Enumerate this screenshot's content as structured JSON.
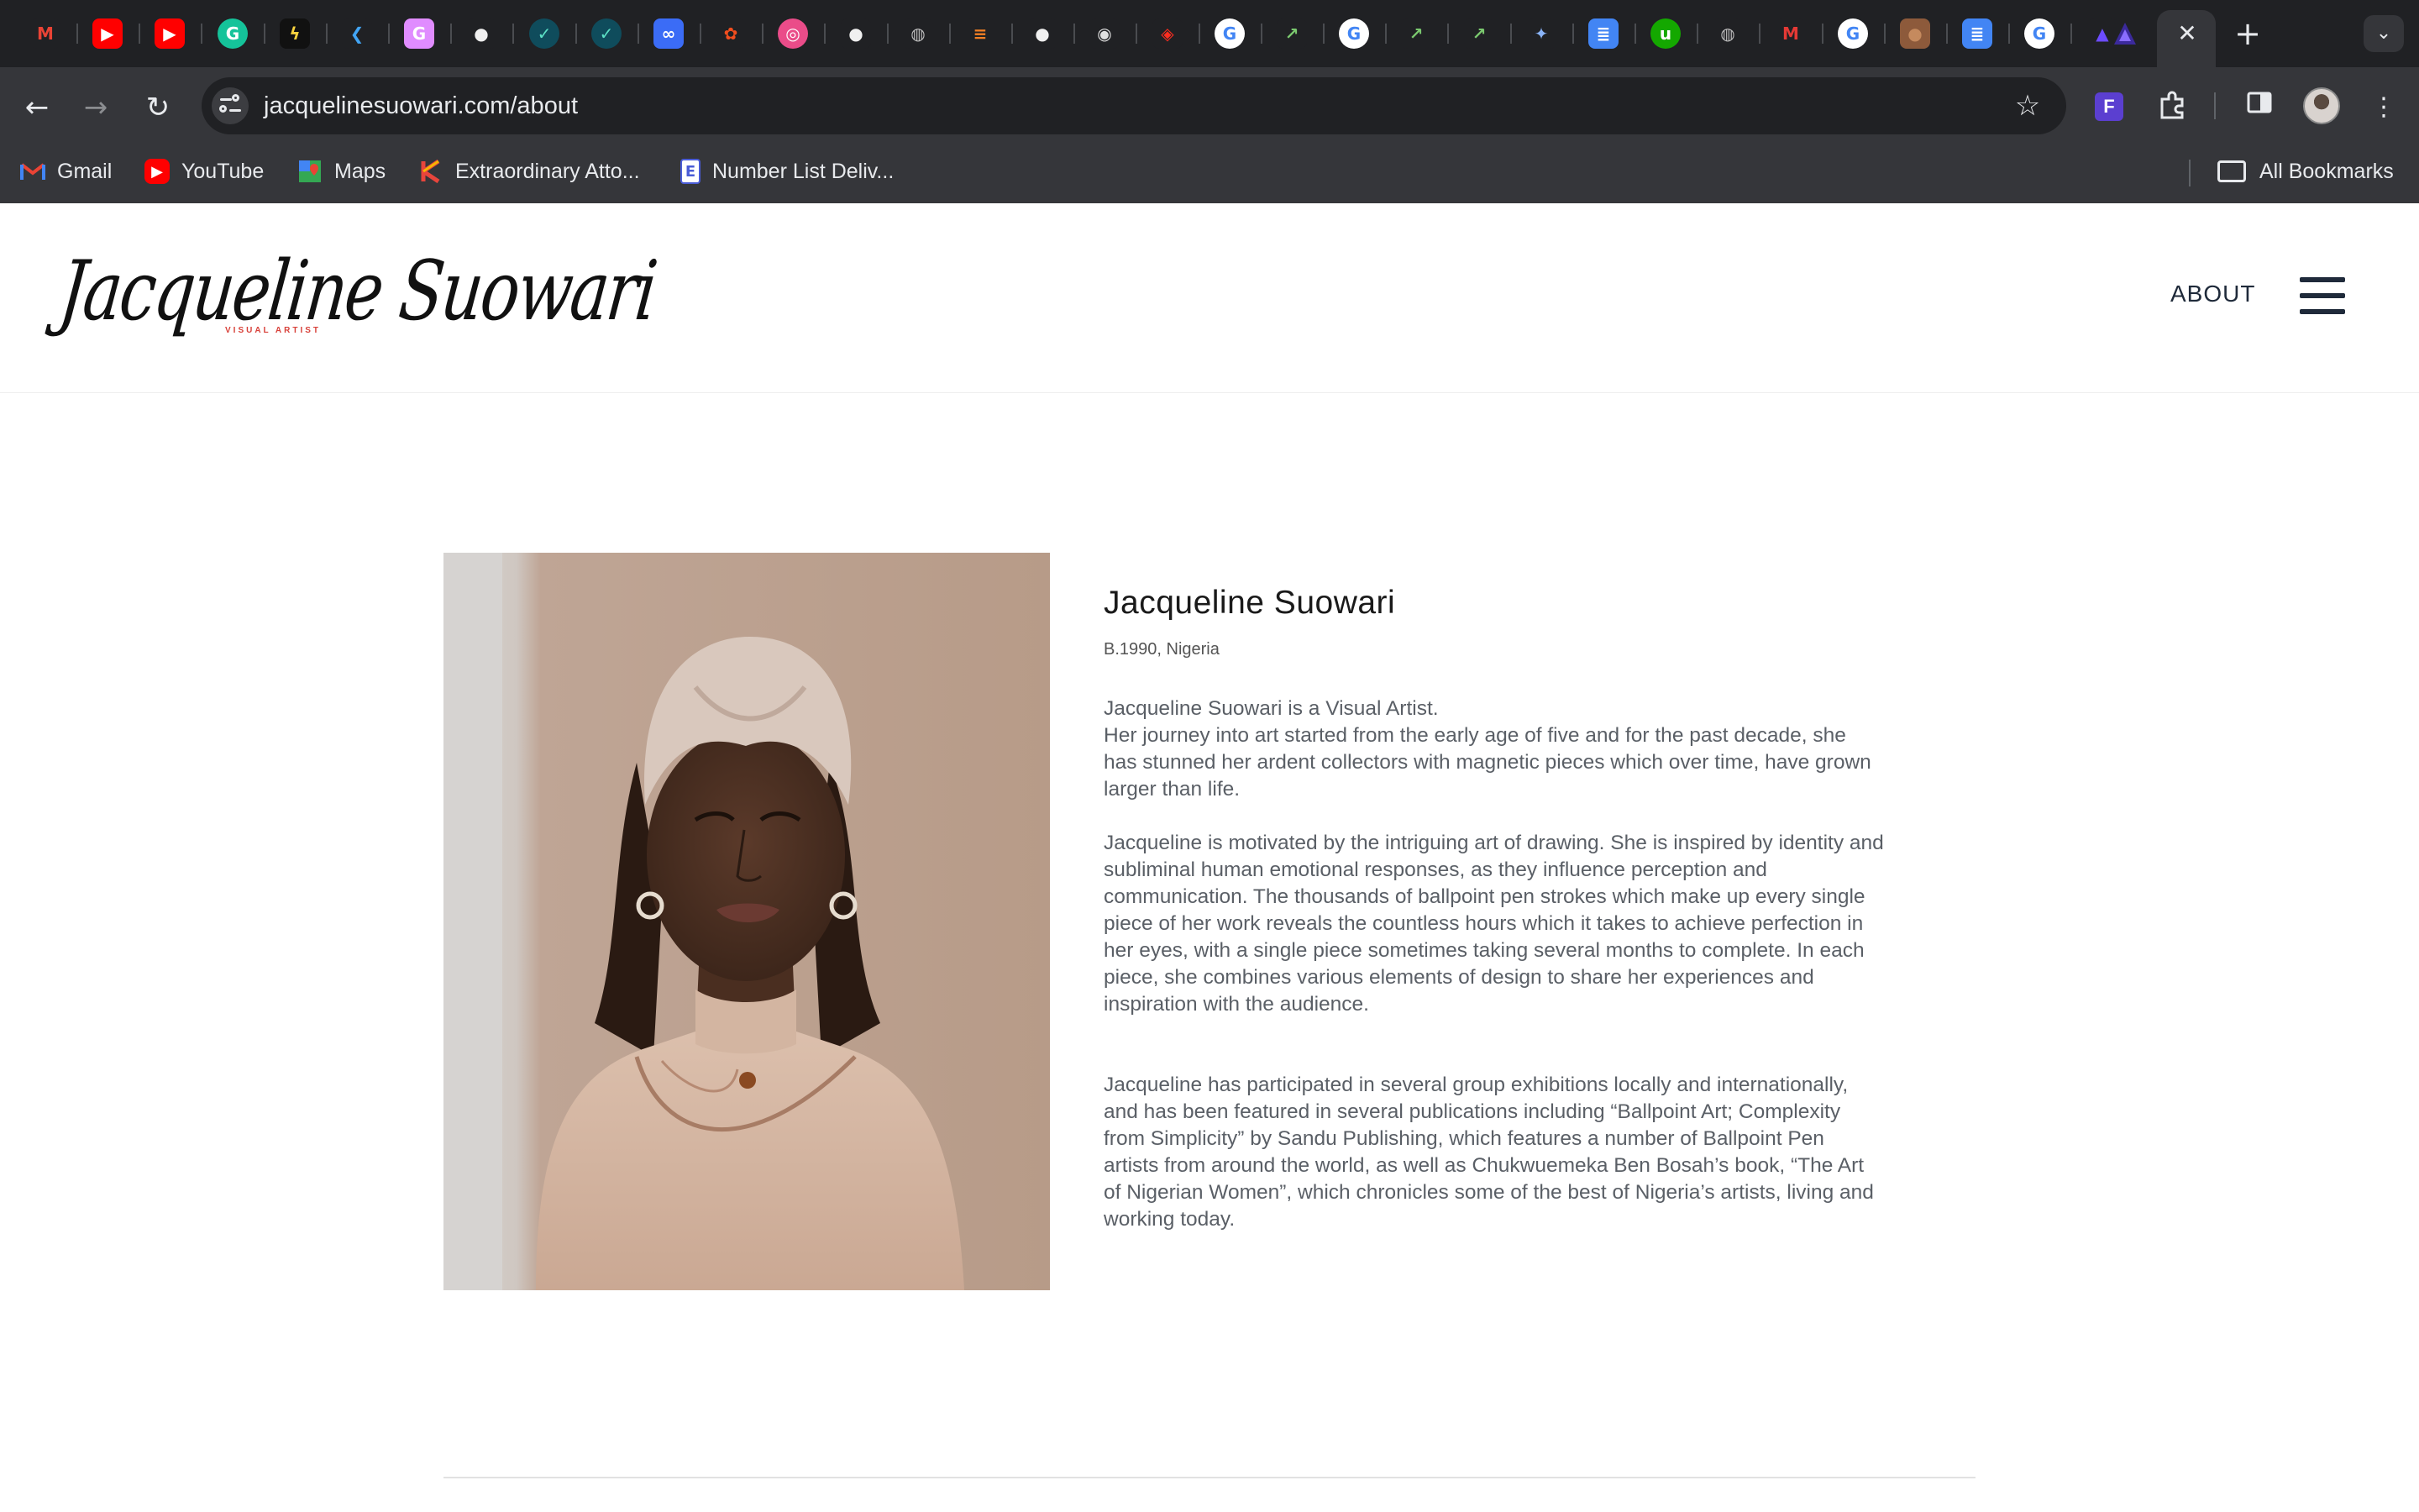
{
  "browser": {
    "tabs_favicons": [
      "gmail-icon",
      "youtube-icon",
      "youtube-icon",
      "grammarly-icon",
      "bolt-icon",
      "flutter-icon",
      "g-icon",
      "github-icon",
      "check-icon",
      "check-icon",
      "link-icon",
      "figma-icon",
      "dribbble-icon",
      "github-icon",
      "globe-icon",
      "stackoverflow-icon",
      "github-icon",
      "ghost-icon",
      "laravel-icon",
      "google-icon",
      "trend-icon",
      "google-icon",
      "trend-icon",
      "trend-icon",
      "gemini-icon",
      "docs-icon",
      "upwork-icon",
      "globe-icon",
      "m-icon",
      "google-icon",
      "avatar-icon",
      "docs-icon",
      "google-icon",
      "arc-icon"
    ],
    "active_tab_close": "✕",
    "new_tab": "+",
    "tab_search": "⌄",
    "back": "←",
    "forward": "→",
    "reload": "↻",
    "url_host": "jacquelinesuowari.com",
    "url_path": "/about",
    "star": "☆",
    "bookmarks": [
      {
        "label": "Gmail",
        "icon": "gmail-icon",
        "color": "#ea4335",
        "glyph": "M"
      },
      {
        "label": "YouTube",
        "icon": "youtube-icon",
        "color": "#ff0000",
        "glyph": "▶"
      },
      {
        "label": "Maps",
        "icon": "maps-icon",
        "color": "#34a853",
        "glyph": "◆"
      },
      {
        "label": "Extraordinary Atto...",
        "icon": "k-icon",
        "color": "#e8453c",
        "glyph": "K"
      },
      {
        "label": "Number List Deliv...",
        "icon": "doc-icon",
        "color": "#4a5cd6",
        "glyph": "E"
      }
    ],
    "all_bookmarks": "All Bookmarks"
  },
  "site": {
    "logo_text": "Jacqueline Suowari",
    "logo_subtitle": "VISUAL ARTIST",
    "nav_about": "ABOUT"
  },
  "about": {
    "name": "Jacqueline Suowari",
    "born": "B.1990, Nigeria",
    "bio_1": "Jacqueline Suowari is a Visual Artist.\nHer journey into art started from the early age of five and for the past decade, she has stunned her ardent collectors with magnetic pieces which over time, have grown larger than life.",
    "bio_2": "Jacqueline is motivated by the intriguing art of drawing. She is inspired by identity and subliminal human emotional responses, as they influence perception and communication. The thousands of ballpoint pen strokes which make up every single piece of her work reveals the countless hours which it takes to achieve perfection in her eyes, with a single piece sometimes taking several months to complete. In each piece, she combines various elements of design to share her experiences and inspiration with the audience.",
    "bio_3": "Jacqueline has participated in several group exhibitions locally and internationally, and has been featured in several publications including “Ballpoint Art; Complexity from Simplicity” by Sandu Publishing, which features a number of Ballpoint Pen artists from around the world, as well as Chukwuemeka Ben Bosah’s book, “The Art of Nigerian Women”, which chronicles some of the best of Nigeria’s artists, living and working today."
  },
  "colors": {
    "chrome_dark": "#202124",
    "chrome_toolbar": "#35363a",
    "accent_red": "#d8413a",
    "nav_text": "#1f2a3a"
  }
}
